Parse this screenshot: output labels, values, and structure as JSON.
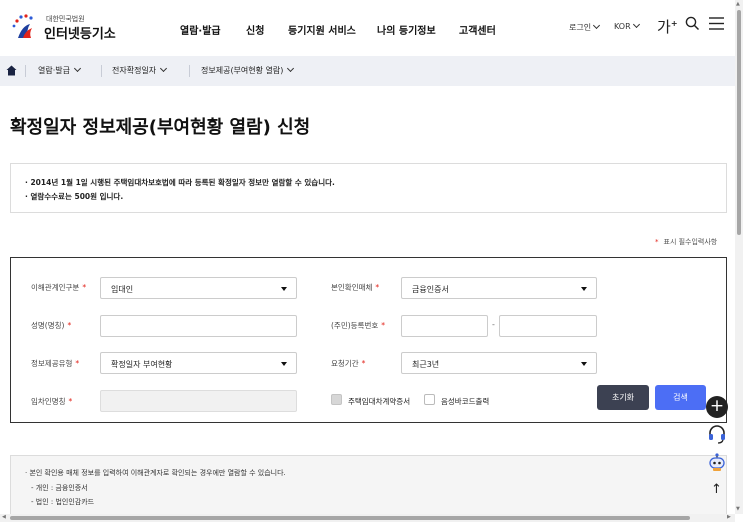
{
  "header": {
    "logo_small": "대한민국법원",
    "logo_big": "인터넷등기소",
    "gnb": [
      "열람·발급",
      "신청",
      "등기지원 서비스",
      "나의 등기정보",
      "고객센터"
    ],
    "login_label": "로그인",
    "lang_label": "KOR",
    "font_size_label": "가",
    "font_size_plus": "+"
  },
  "breadcrumb": {
    "items": [
      "열람·발급",
      "전자확정일자",
      "정보제공(부여현황 열람)"
    ]
  },
  "page": {
    "title": "확정일자 정보제공(부여현황 열람) 신청"
  },
  "notice": {
    "lines": [
      "· 2014년 1월 1일 시행된 주택임대차보호법에 따라 등록된 확정일자 정보만 열람할 수 있습니다.",
      "· 열람수수료는 500원 입니다."
    ]
  },
  "required_note": {
    "star": "*",
    "text": "표시 필수입력사항"
  },
  "form": {
    "required_mark": "*",
    "relation_label": "이해관계인구분",
    "relation_value": "임대인",
    "auth_label": "본인확인매체",
    "auth_value": "금융인증서",
    "name_label": "성명(명칭)",
    "name_value": "",
    "regno_label": "(주민)등록번호",
    "regno_value1": "",
    "regno_dash": "-",
    "regno_value2": "",
    "info_type_label": "정보제공유형",
    "info_type_value": "확정일자 부여현황",
    "period_label": "요청기간",
    "period_value": "최근3년",
    "tenant_label": "임차인명칭",
    "tenant_value": "",
    "checkbox1_label": "주택임대차계약증서",
    "checkbox1_checked": false,
    "checkbox2_label": "음성바코드출력",
    "checkbox2_checked": false,
    "reset_label": "초기화",
    "search_label": "검색"
  },
  "info": {
    "lines": [
      "· 본인 확인용 매체 정보를 입력하여 이해관계자로 확인되는 경우에만 열람할 수 있습니다.",
      "- 개인 : 금융인증서",
      "- 법인 : 법인인감카드"
    ]
  },
  "quick": {
    "plus_label": "+",
    "top_label": "↑"
  },
  "colors": {
    "accent": "#4c6ef5",
    "reset_button": "#3c4152",
    "required": "#e2231a",
    "breadcrumb_bg": "#eef0f5"
  },
  "icons": [
    "home-icon",
    "search-icon",
    "menu-icon",
    "headset-icon",
    "chatbot-icon",
    "arrow-up-icon"
  ]
}
